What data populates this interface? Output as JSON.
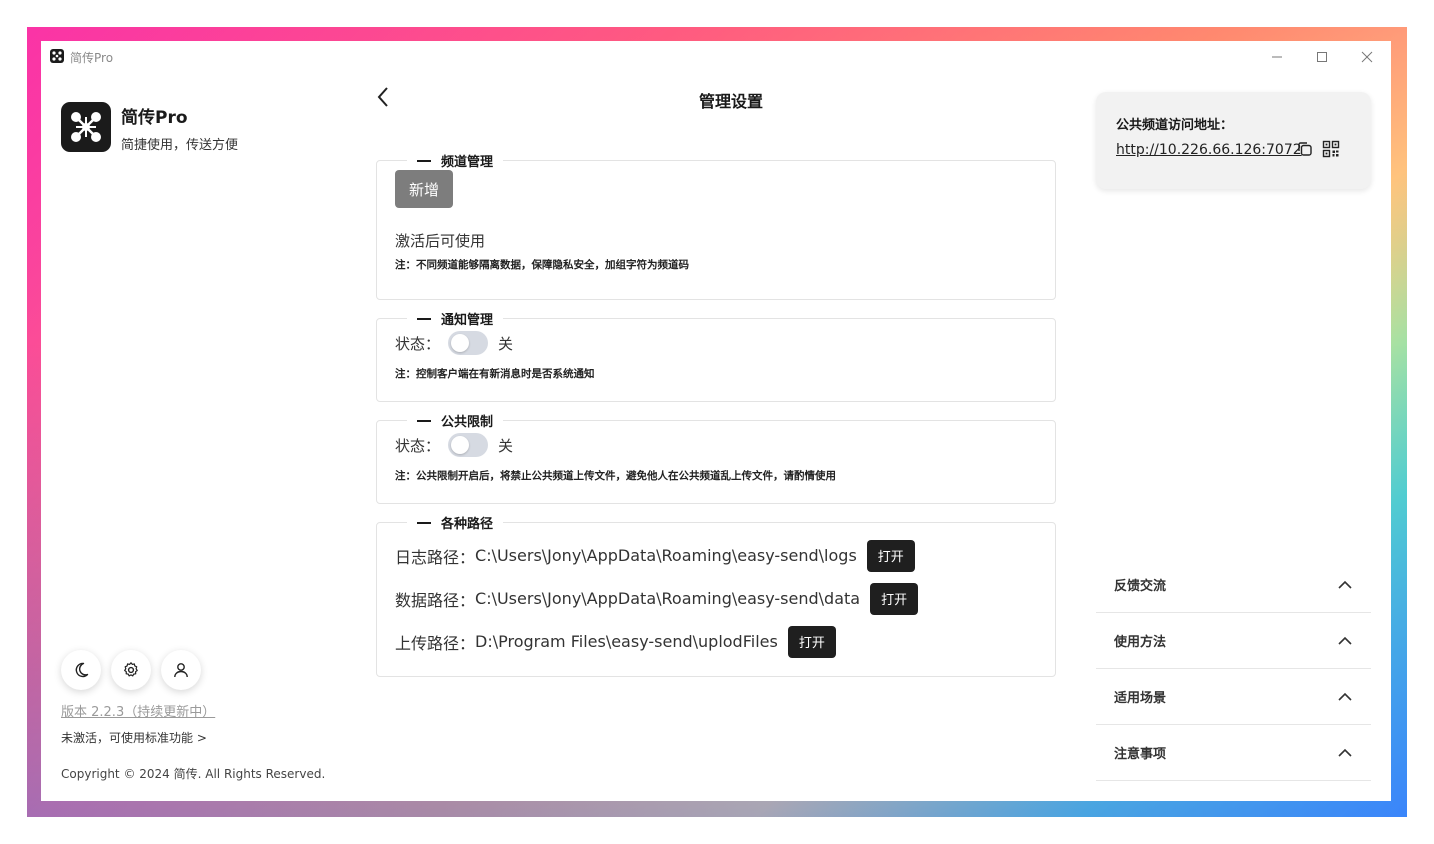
{
  "window": {
    "title": "简传Pro",
    "controls": [
      "minimize-icon",
      "maximize-icon",
      "close-icon"
    ]
  },
  "sidebar": {
    "app_name": "简传Pro",
    "app_slogan": "简捷使用，传送方便",
    "icons": [
      "moon-icon",
      "gear-icon",
      "user-icon"
    ],
    "version": "版本 2.2.3（持续更新中）",
    "activation": "未激活，可使用标准功能 >",
    "copyright": "Copyright © 2024 简传. All Rights Reserved."
  },
  "main": {
    "title": "管理设置",
    "channel": {
      "legend": "频道管理",
      "add_button": "新增",
      "hint": "激活后可使用",
      "note": "注：不同频道能够隔离数据，保障隐私安全，加组字符为频道码"
    },
    "notify": {
      "legend": "通知管理",
      "status_label": "状态：",
      "state_text": "关",
      "enabled": false,
      "note": "注：控制客户端在有新消息时是否系统通知"
    },
    "public_limit": {
      "legend": "公共限制",
      "status_label": "状态：",
      "state_text": "关",
      "enabled": false,
      "note": "注：公共限制开启后，将禁止公共频道上传文件，避免他人在公共频道乱上传文件，请酌情使用"
    },
    "paths": {
      "legend": "各种路径",
      "items": [
        {
          "label": "日志路径：",
          "value": "C:\\Users\\Jony\\AppData\\Roaming\\easy-send\\logs",
          "button": "打开"
        },
        {
          "label": "数据路径：",
          "value": "C:\\Users\\Jony\\AppData\\Roaming\\easy-send\\data",
          "button": "打开"
        },
        {
          "label": "上传路径：",
          "value": "D:\\Program Files\\easy-send\\uplodFiles",
          "button": "打开"
        }
      ]
    }
  },
  "right_panel": {
    "address_label": "公共频道访问地址：",
    "address_url": "http://10.226.66.126:7072",
    "accordion": [
      {
        "label": "反馈交流"
      },
      {
        "label": "使用方法"
      },
      {
        "label": "适用场景"
      },
      {
        "label": "注意事项"
      }
    ]
  },
  "colors": {
    "toggle_off": "#d6dae2",
    "dark_button": "#1f1f1f",
    "disabled_button": "#7d7d7d"
  }
}
